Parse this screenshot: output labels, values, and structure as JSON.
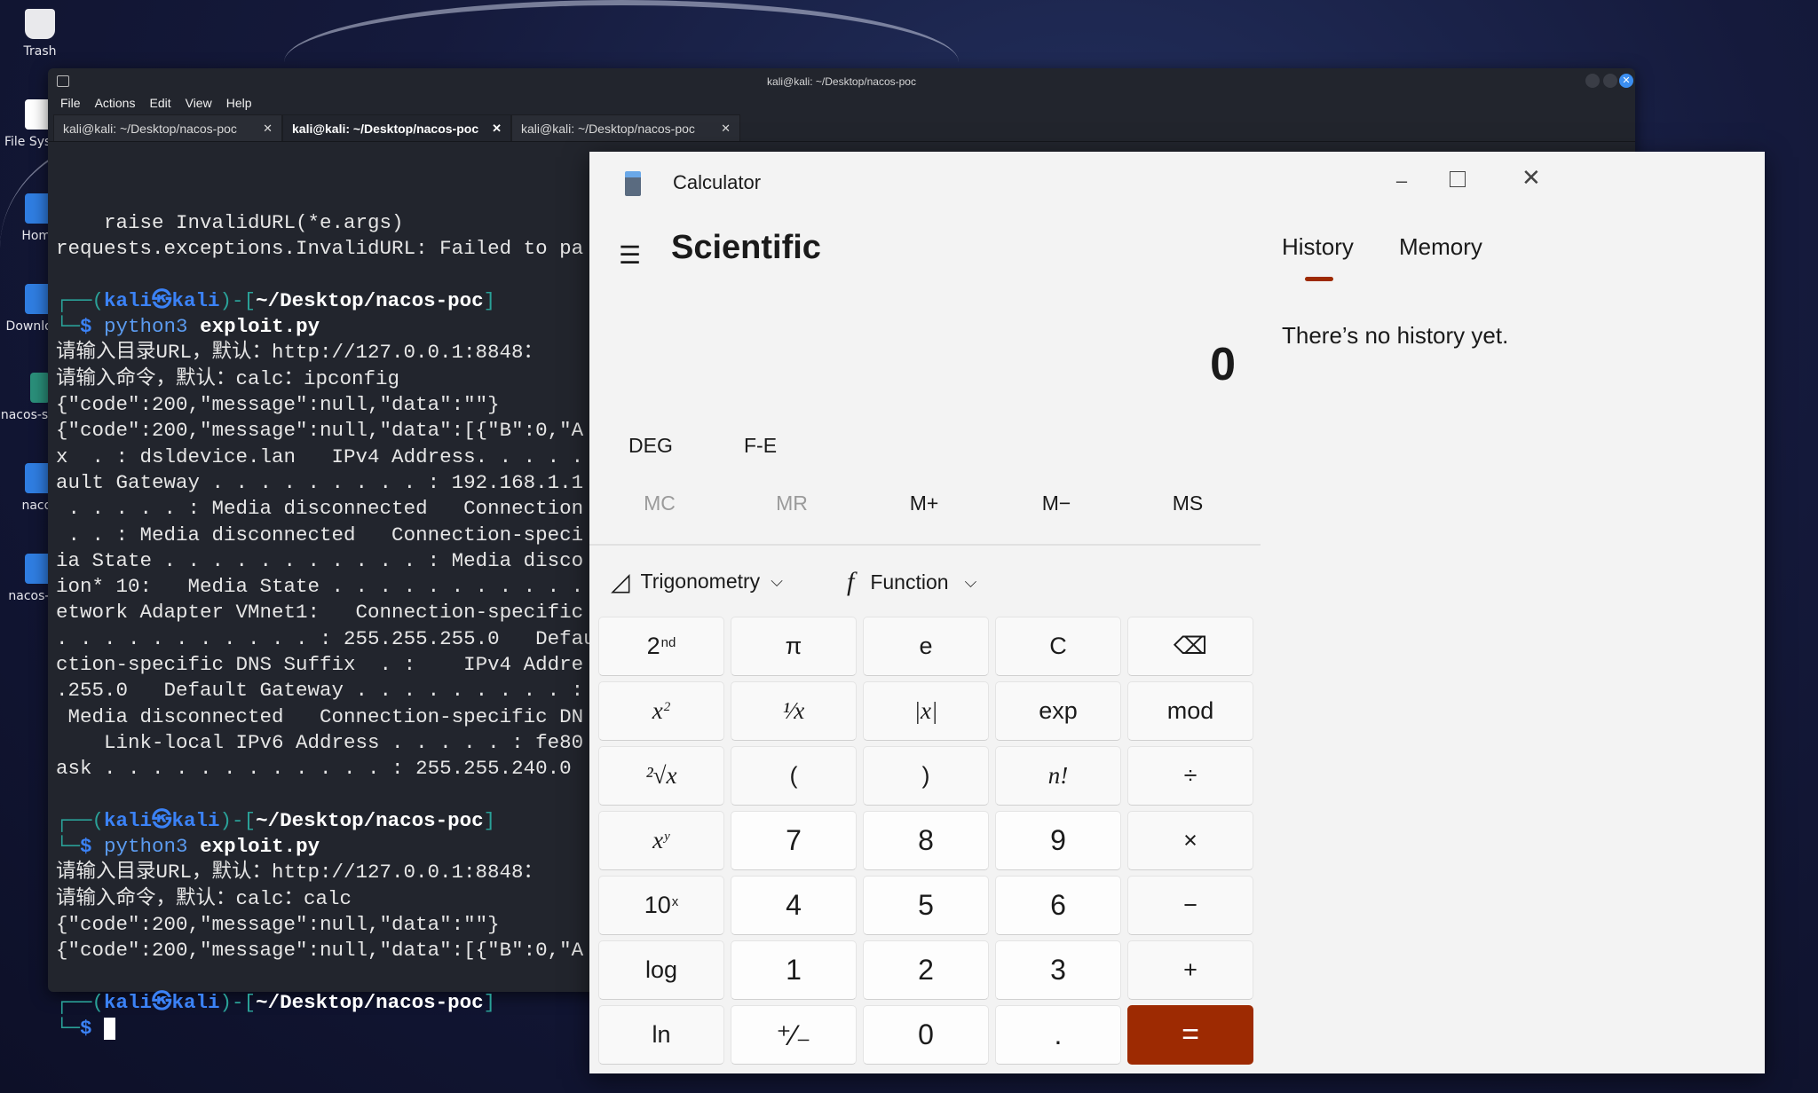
{
  "desktop": {
    "icons": [
      {
        "label": "Trash",
        "icon": "trash-icon"
      },
      {
        "label": "File System",
        "icon": "drive-icon"
      },
      {
        "label": "Home",
        "icon": "home-folder-icon"
      },
      {
        "label": "Downloads",
        "icon": "folder-icon"
      },
      {
        "label": "nacos-serv...",
        "icon": "archive-icon"
      },
      {
        "label": "nacos",
        "icon": "folder-icon"
      },
      {
        "label": "nacos-poc",
        "icon": "folder-icon"
      }
    ]
  },
  "terminal": {
    "title": "kali@kali: ~/Desktop/nacos-poc",
    "menu": [
      "File",
      "Actions",
      "Edit",
      "View",
      "Help"
    ],
    "tabs": [
      {
        "label": "kali@kali: ~/Desktop/nacos-poc",
        "active": false
      },
      {
        "label": "kali@kali: ~/Desktop/nacos-poc",
        "active": true
      },
      {
        "label": "kali@kali: ~/Desktop/nacos-poc",
        "active": false
      }
    ],
    "prompt": {
      "user": "kali",
      "host": "kali",
      "cwd": "~/Desktop/nacos-poc"
    },
    "lines": [
      {
        "t": "text",
        "v": "    raise InvalidURL(*e.args)"
      },
      {
        "t": "text",
        "v": "requests.exceptions.InvalidURL: Failed to pa"
      },
      {
        "t": "text",
        "v": ""
      },
      {
        "t": "prompt"
      },
      {
        "t": "cmd",
        "prog": "python3",
        "arg": "exploit.py"
      },
      {
        "t": "text",
        "v": "请输入目录URL，默认：http://127.0.0.1:8848："
      },
      {
        "t": "text",
        "v": "请输入命令，默认：calc：ipconfig"
      },
      {
        "t": "text",
        "v": "{\"code\":200,\"message\":null,\"data\":\"\"}"
      },
      {
        "t": "text",
        "v": "{\"code\":200,\"message\":null,\"data\":[{\"B\":0,\"A"
      },
      {
        "t": "text",
        "v": "x  . : dsldevice.lan   IPv4 Address. . . . ."
      },
      {
        "t": "text",
        "v": "ault Gateway . . . . . . . . . : 192.168.1.1"
      },
      {
        "t": "text",
        "v": " . . . . . : Media disconnected   Connection"
      },
      {
        "t": "text",
        "v": " . . : Media disconnected   Connection-speci"
      },
      {
        "t": "text",
        "v": "ia State . . . . . . . . . . . : Media disco"
      },
      {
        "t": "text",
        "v": "ion* 10:   Media State . . . . . . . . . . ."
      },
      {
        "t": "text",
        "v": "etwork Adapter VMnet1:   Connection-specific"
      },
      {
        "t": "text",
        "v": ". . . . . . . . . . . : 255.255.255.0   Defaul"
      },
      {
        "t": "text",
        "v": "ction-specific DNS Suffix  . :    IPv4 Addre"
      },
      {
        "t": "text",
        "v": ".255.0   Default Gateway . . . . . . . . . :"
      },
      {
        "t": "text",
        "v": " Media disconnected   Connection-specific DN"
      },
      {
        "t": "text",
        "v": "    Link-local IPv6 Address . . . . . : fe80"
      },
      {
        "t": "text",
        "v": "ask . . . . . . . . . . . . : 255.255.240.0"
      },
      {
        "t": "text",
        "v": ""
      },
      {
        "t": "prompt"
      },
      {
        "t": "cmd",
        "prog": "python3",
        "arg": "exploit.py"
      },
      {
        "t": "text",
        "v": "请输入目录URL，默认：http://127.0.0.1:8848："
      },
      {
        "t": "text",
        "v": "请输入命令，默认：calc：calc"
      },
      {
        "t": "text",
        "v": "{\"code\":200,\"message\":null,\"data\":\"\"}"
      },
      {
        "t": "text",
        "v": "{\"code\":200,\"message\":null,\"data\":[{\"B\":0,\"A"
      },
      {
        "t": "text",
        "v": ""
      },
      {
        "t": "prompt"
      },
      {
        "t": "cursor"
      }
    ]
  },
  "calculator": {
    "title": "Calculator",
    "mode": "Scientific",
    "display": "0",
    "angle_unit": "DEG",
    "fe_label": "F-E",
    "panel_tabs": [
      "History",
      "Memory"
    ],
    "active_panel": "History",
    "history_empty": "There’s no history yet.",
    "memory_buttons": [
      {
        "label": "MC",
        "enabled": false
      },
      {
        "label": "MR",
        "enabled": false
      },
      {
        "label": "M+",
        "enabled": true
      },
      {
        "label": "M−",
        "enabled": true
      },
      {
        "label": "MS",
        "enabled": true
      }
    ],
    "dropdowns": [
      "Trigonometry",
      "Function"
    ],
    "accent_color": "#9d2a02",
    "keys": [
      [
        {
          "l": "2",
          "sup": "nd",
          "n": "second"
        },
        {
          "l": "π",
          "n": "pi"
        },
        {
          "l": "e",
          "n": "e"
        },
        {
          "l": "C",
          "n": "clear"
        },
        {
          "l": "⌫",
          "n": "backspace"
        }
      ],
      [
        {
          "l": "x",
          "sup": "2",
          "it": true,
          "n": "square"
        },
        {
          "l": "¹⁄x",
          "it": true,
          "n": "reciprocal"
        },
        {
          "l": "|x|",
          "it": true,
          "n": "abs"
        },
        {
          "l": "exp",
          "n": "exp"
        },
        {
          "l": "mod",
          "n": "mod"
        }
      ],
      [
        {
          "l": "²√x",
          "it": true,
          "n": "sqrt"
        },
        {
          "l": "(",
          "n": "open-paren"
        },
        {
          "l": ")",
          "n": "close-paren"
        },
        {
          "l": "n!",
          "it": true,
          "n": "factorial"
        },
        {
          "l": "÷",
          "n": "divide"
        }
      ],
      [
        {
          "l": "x",
          "sup": "y",
          "it": true,
          "n": "power"
        },
        {
          "l": "7",
          "num": true,
          "n": "7"
        },
        {
          "l": "8",
          "num": true,
          "n": "8"
        },
        {
          "l": "9",
          "num": true,
          "n": "9"
        },
        {
          "l": "×",
          "n": "multiply"
        }
      ],
      [
        {
          "l": "10",
          "sup": "x",
          "n": "ten-power"
        },
        {
          "l": "4",
          "num": true,
          "n": "4"
        },
        {
          "l": "5",
          "num": true,
          "n": "5"
        },
        {
          "l": "6",
          "num": true,
          "n": "6"
        },
        {
          "l": "−",
          "n": "minus"
        }
      ],
      [
        {
          "l": "log",
          "n": "log"
        },
        {
          "l": "1",
          "num": true,
          "n": "1"
        },
        {
          "l": "2",
          "num": true,
          "n": "2"
        },
        {
          "l": "3",
          "num": true,
          "n": "3"
        },
        {
          "l": "+",
          "n": "plus"
        }
      ],
      [
        {
          "l": "ln",
          "n": "ln"
        },
        {
          "l": "⁺⁄₋",
          "num": true,
          "n": "negate"
        },
        {
          "l": "0",
          "num": true,
          "n": "0"
        },
        {
          "l": ".",
          "num": true,
          "n": "decimal"
        },
        {
          "l": "=",
          "eq": true,
          "n": "equals"
        }
      ]
    ]
  }
}
